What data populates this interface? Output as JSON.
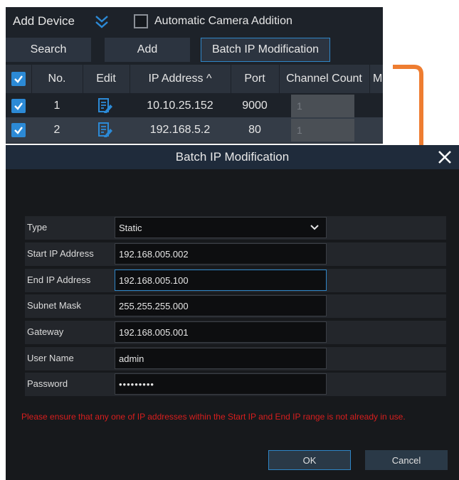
{
  "add_device": {
    "title": "Add Device",
    "expand_icon": "double-chevron-down-icon",
    "auto_addition_label": "Automatic Camera Addition",
    "buttons": {
      "search": "Search",
      "add": "Add",
      "batch": "Batch IP Modification"
    },
    "columns": [
      "No.",
      "Edit",
      "IP Address ^",
      "Port",
      "Channel Count",
      "M"
    ],
    "rows": [
      {
        "no": "1",
        "ip": "10.10.25.152",
        "port": "9000",
        "channel": "1"
      },
      {
        "no": "2",
        "ip": "192.168.5.2",
        "port": "80",
        "channel": "1"
      }
    ]
  },
  "dialog": {
    "title": "Batch IP Modification",
    "fields": {
      "type_label": "Type",
      "type_value": "Static",
      "start_label": "Start IP Address",
      "start_value": "192.168.005.002",
      "end_label": "End IP Address",
      "end_value": "192.168.005.100",
      "subnet_label": "Subnet Mask",
      "subnet_value": "255.255.255.000",
      "gateway_label": "Gateway",
      "gateway_value": "192.168.005.001",
      "user_label": "User Name",
      "user_value": "admin",
      "password_label": "Password",
      "password_value": "•••••••••"
    },
    "warning": "Please ensure that any one of IP addresses within the Start IP and End IP range is not already in use.",
    "ok": "OK",
    "cancel": "Cancel"
  },
  "colors": {
    "accent": "#2c8ad6",
    "arrow": "#ee7d31",
    "warning": "#d81e1e"
  }
}
